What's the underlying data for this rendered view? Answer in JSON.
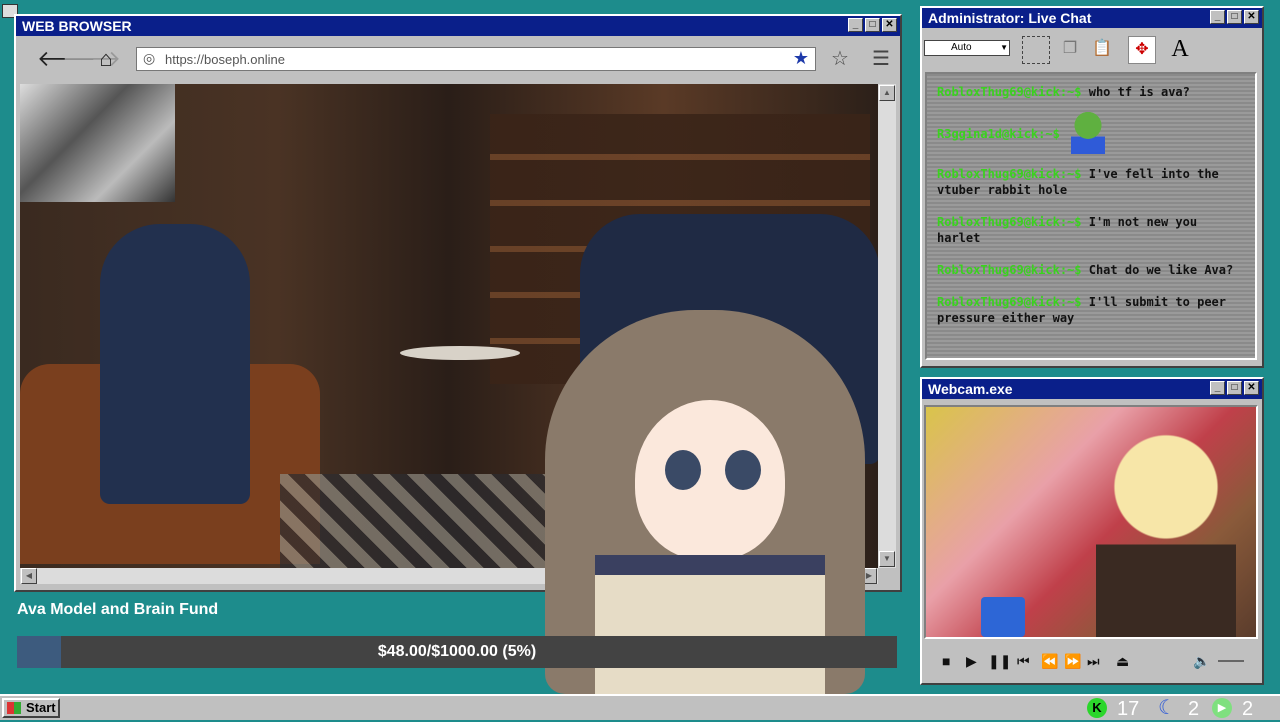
{
  "browser": {
    "title": "WEB BROWSER",
    "url": "https://boseph.online",
    "icons": {
      "back": "back-arrow-icon",
      "forward": "forward-arrow-icon",
      "home": "home-icon",
      "globe": "globe-icon",
      "bookmarked": "star-filled-icon",
      "bookmark": "star-outline-icon",
      "menu": "hamburger-menu-icon"
    }
  },
  "chat": {
    "title": "Administrator: Live Chat",
    "font_size_value": "Auto",
    "messages": [
      {
        "user": "RobloxThug69@kick:~$",
        "text": " who tf is ava?"
      },
      {
        "user": "R3ggina1d@kick:~$",
        "text": ""
      },
      {
        "user": "RobloxThug69@kick:~$",
        "text": " I've fell into the vtuber rabbit hole"
      },
      {
        "user": "RobloxThug69@kick:~$",
        "text": " I'm not new you harlet"
      },
      {
        "user": "RobloxThug69@kick:~$",
        "text": " Chat do we like Ava?"
      },
      {
        "user": "RobloxThug69@kick:~$",
        "text": " I'll submit to peer pressure either way"
      }
    ]
  },
  "webcam": {
    "title": "Webcam.exe"
  },
  "fund": {
    "title": "Ava Model and Brain Fund",
    "progress_text": "$48.00/$1000.00 (5%)",
    "progress_fraction": 0.05,
    "fill_color": "#3d5b7e"
  },
  "taskbar": {
    "start_label": "Start",
    "tray": {
      "kick_count": "17",
      "moon_count": "2",
      "play_count": "2"
    }
  },
  "window_controls": {
    "minimize": "_",
    "maximize": "□",
    "close": "✕"
  }
}
